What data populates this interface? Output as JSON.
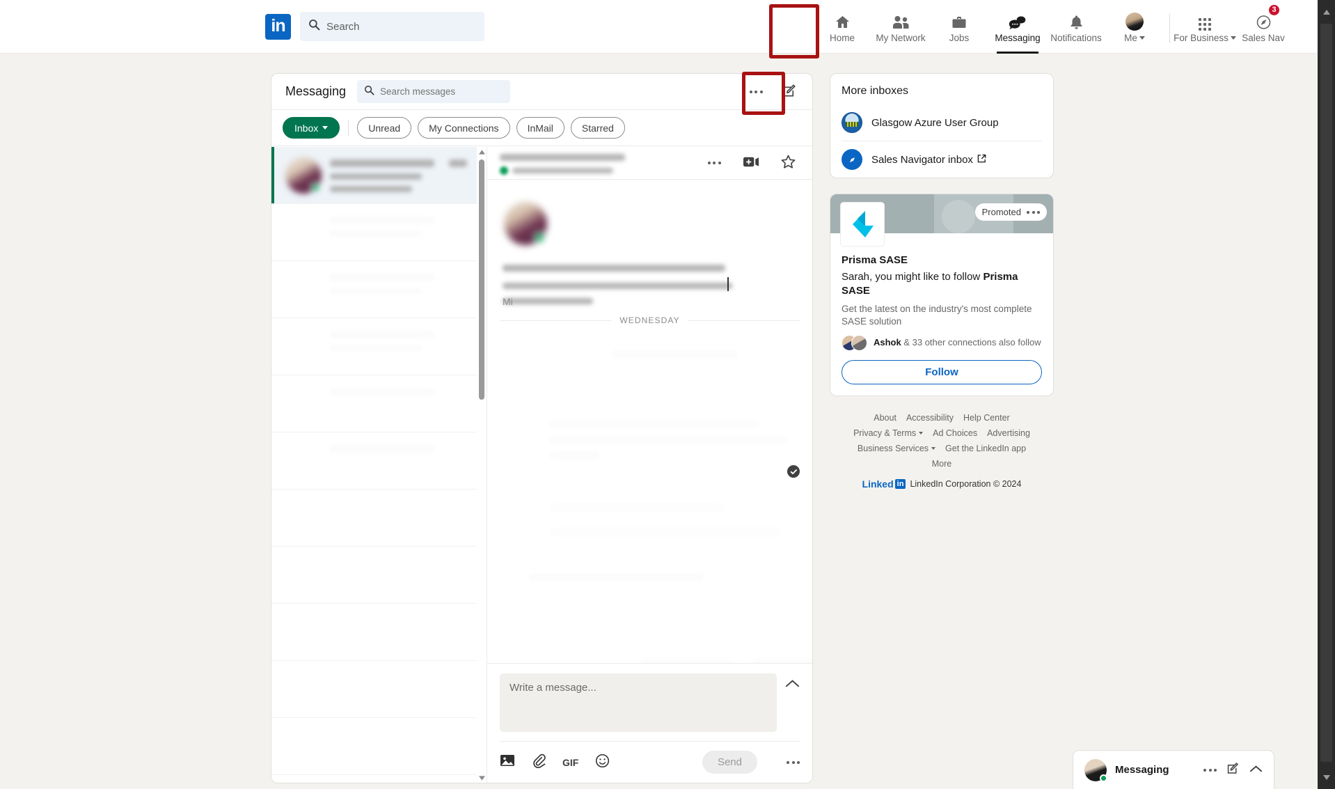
{
  "global_nav": {
    "logo_text": "in",
    "search_placeholder": "Search",
    "search_value": "",
    "items": [
      {
        "label": "Home",
        "icon": "home-icon",
        "active": false
      },
      {
        "label": "My Network",
        "icon": "people-icon",
        "active": false
      },
      {
        "label": "Jobs",
        "icon": "briefcase-icon",
        "active": false
      },
      {
        "label": "Messaging",
        "icon": "message-bubble-icon",
        "active": true
      },
      {
        "label": "Notifications",
        "icon": "bell-icon",
        "active": false
      },
      {
        "label": "Me",
        "icon": "avatar-icon",
        "active": false
      },
      {
        "label": "For Business",
        "icon": "grid-icon",
        "active": false
      },
      {
        "label": "Sales Nav",
        "icon": "compass-icon",
        "active": false,
        "badge": "3"
      }
    ]
  },
  "messaging": {
    "title": "Messaging",
    "search_placeholder": "Search messages",
    "search_value": "",
    "overflow_icon": "more-options-icon",
    "compose_icon": "compose-pencil-icon",
    "filters": [
      {
        "label": "Inbox",
        "primary": true,
        "has_caret": true
      },
      {
        "label": "Unread",
        "primary": false
      },
      {
        "label": "My Connections",
        "primary": false
      },
      {
        "label": "InMail",
        "primary": false
      },
      {
        "label": "Starred",
        "primary": false
      }
    ],
    "conversation_list": {
      "selected_index": 0,
      "redacted": true,
      "row_count": 10
    },
    "thread": {
      "header_redacted": true,
      "actions": [
        {
          "icon": "more-options-icon"
        },
        {
          "icon": "video-add-icon"
        },
        {
          "icon": "star-outline-icon"
        }
      ],
      "message_prefix_visible": "Mi",
      "day_divider": "WEDNESDAY",
      "read_receipt_icon": "check-circle-icon",
      "body_redacted": true
    },
    "composer": {
      "placeholder": "Write a message...",
      "value": "",
      "expand_icon": "chevron-up-icon",
      "tools": [
        {
          "icon": "image-icon",
          "label": ""
        },
        {
          "icon": "paperclip-icon",
          "label": ""
        },
        {
          "icon": "gif-icon",
          "label": "GIF"
        },
        {
          "icon": "emoji-icon",
          "label": ""
        }
      ],
      "send_label": "Send",
      "more_icon": "more-options-icon",
      "send_enabled": false
    }
  },
  "right_rail": {
    "more_inboxes": {
      "title": "More inboxes",
      "items": [
        {
          "label": "Glasgow Azure User Group",
          "icon": "group-avatar-icon",
          "external": false
        },
        {
          "label": "Sales Navigator inbox",
          "icon": "compass-icon",
          "external": true
        }
      ]
    },
    "ad": {
      "promoted_label": "Promoted",
      "overflow_icon": "more-options-icon",
      "logo_icon": "prisma-sase-logo",
      "company": "Prisma SASE",
      "headline_prefix": "Sarah, you might like to follow ",
      "headline_bold": "Prisma SASE",
      "subtext": "Get the latest on the industry's most complete SASE solution",
      "social_bold": "Ashok",
      "social_rest": " & 33 other connections also follow",
      "follow_label": "Follow"
    },
    "footer": {
      "row1": [
        "About",
        "Accessibility",
        "Help Center"
      ],
      "row2": [
        {
          "label": "Privacy & Terms",
          "caret": true
        },
        {
          "label": "Ad Choices",
          "caret": false
        },
        {
          "label": "Advertising",
          "caret": false
        }
      ],
      "row3": [
        {
          "label": "Business Services",
          "caret": true
        },
        {
          "label": "Get the LinkedIn app",
          "caret": false
        }
      ],
      "row4": [
        "More"
      ],
      "brand_word": "Linked",
      "brand_mark": "in",
      "copyright": "LinkedIn Corporation © 2024"
    }
  },
  "dock": {
    "title": "Messaging",
    "actions": [
      {
        "icon": "more-options-icon"
      },
      {
        "icon": "compose-pencil-icon"
      },
      {
        "icon": "chevron-up-icon"
      }
    ]
  },
  "annotations": {
    "color": "#a81212",
    "boxes": [
      {
        "target": "nav-item-messaging"
      },
      {
        "target": "messaging-overflow-button"
      }
    ]
  }
}
